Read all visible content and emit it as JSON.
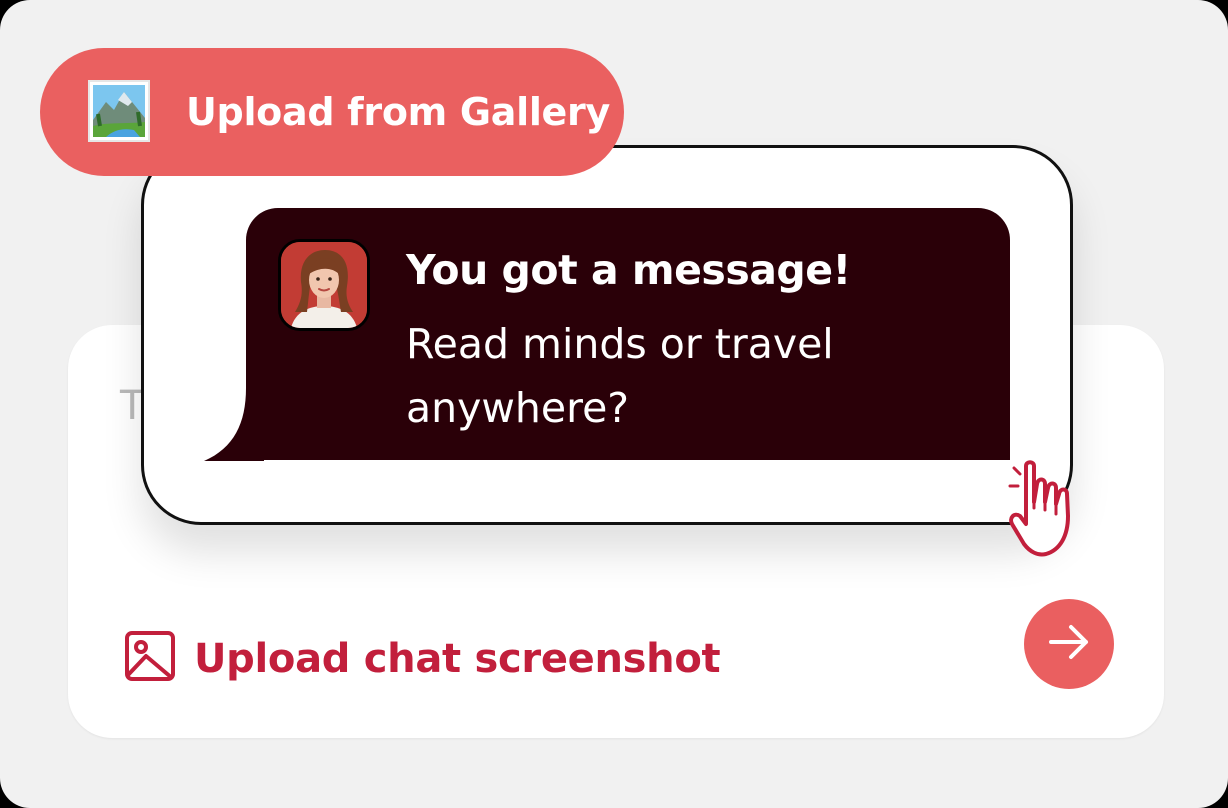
{
  "gallery_button": {
    "label": "Upload from Gallery",
    "icon": "landscape-photo-icon",
    "color": "#ea6060"
  },
  "notification": {
    "title": "You got a message!",
    "body": "Read minds or travel anywhere?",
    "avatar": "avatar",
    "bubble_color": "#2a0008"
  },
  "input_card": {
    "placeholder_partial": "T",
    "upload_label": "Upload chat screenshot",
    "upload_icon": "image-icon",
    "send_icon": "arrow-right-icon",
    "accent_color": "#c21f3c",
    "send_color": "#ea5f60"
  },
  "cursor": {
    "icon": "hand-pointer-icon"
  }
}
